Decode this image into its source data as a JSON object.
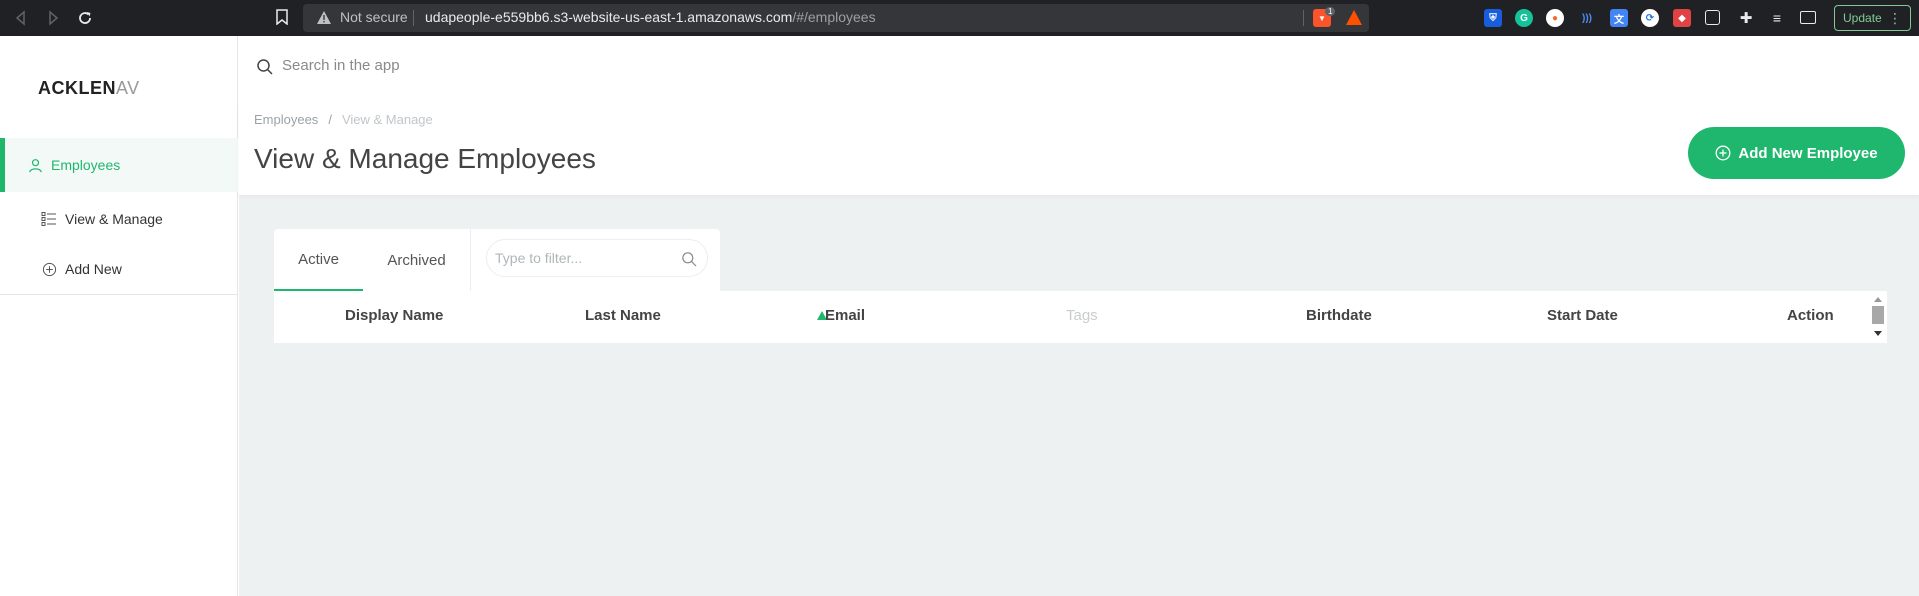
{
  "browser": {
    "security_label": "Not secure",
    "url_host": "udapeople-e559bb6.s3-website-us-east-1.amazonaws.com",
    "url_path": "/#/employees",
    "shield_count": "1",
    "update_label": "Update",
    "extensions": [
      "bitwarden-icon",
      "grammarly-icon",
      "honey-icon",
      "read-aloud-icon",
      "translate-icon",
      "sync-icon",
      "extension-red-icon",
      "screenshot-icon",
      "puzzle-icon",
      "reading-list-icon",
      "wallet-icon"
    ]
  },
  "sidebar": {
    "logo_main": "ACKLEN",
    "logo_fade": "AV",
    "items": [
      {
        "label": "Employees",
        "icon": "user-icon",
        "active": true
      },
      {
        "label": "View & Manage",
        "icon": "list-icon"
      },
      {
        "label": "Add New",
        "icon": "plus-circle-icon"
      }
    ]
  },
  "search": {
    "placeholder": "Search in the app"
  },
  "breadcrumb": [
    "Employees",
    "View & Manage"
  ],
  "page_title": "View & Manage Employees",
  "add_button": "Add New Employee",
  "tabs": [
    "Active",
    "Archived"
  ],
  "filter": {
    "placeholder": "Type to filter..."
  },
  "table": {
    "columns": [
      "Display Name",
      "Last Name",
      "Email",
      "Tags",
      "Birthdate",
      "Start Date",
      "Action"
    ],
    "sorted_column": "Email"
  },
  "colors": {
    "accent": "#1fb76e"
  }
}
